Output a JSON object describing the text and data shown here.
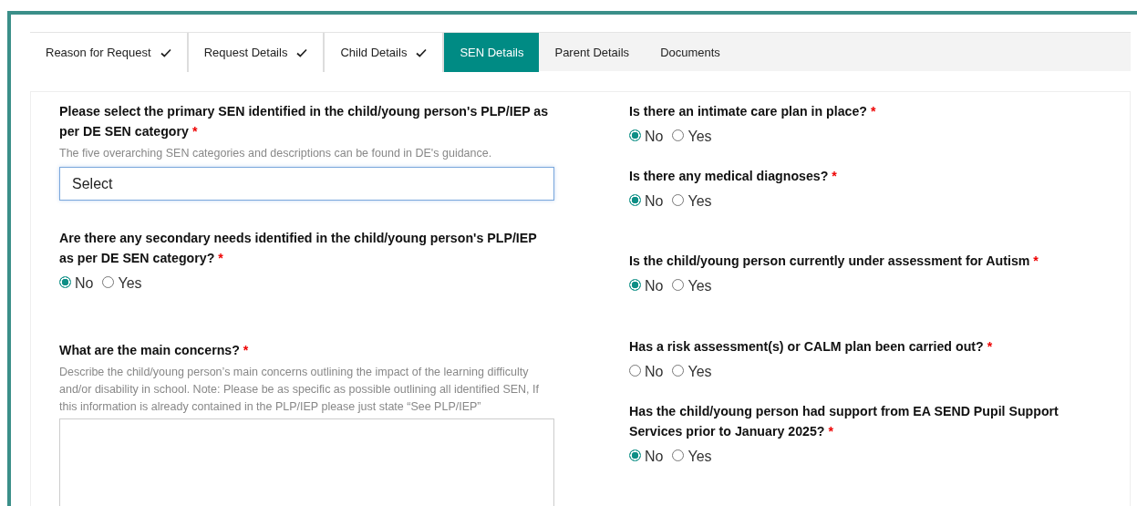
{
  "tabs": [
    {
      "label": "Reason for Request",
      "completed": true,
      "selected": false
    },
    {
      "label": "Request Details",
      "completed": true,
      "selected": false
    },
    {
      "label": "Child Details",
      "completed": true,
      "selected": false
    },
    {
      "label": "SEN Details",
      "completed": false,
      "selected": true
    },
    {
      "label": "Parent Details",
      "completed": false,
      "selected": false
    },
    {
      "label": "Documents",
      "completed": false,
      "selected": false
    }
  ],
  "left_column": [
    {
      "kind": "select",
      "label": "Please select the primary SEN identified in the child/young person's PLP/IEP as per DE SEN category",
      "required_mark": "*",
      "hint": "The five overarching SEN categories and descriptions can be found in DE's guidance.",
      "value": "Select"
    },
    {
      "kind": "radio",
      "label": "Are there any secondary needs identified in the child/young person's PLP/IEP as per DE SEN category?",
      "required_mark": "*",
      "options": [
        {
          "label": "No",
          "selected": true
        },
        {
          "label": "Yes",
          "selected": false
        }
      ]
    },
    {
      "kind": "textarea",
      "label": "What are the main concerns?",
      "required_mark": "*",
      "hint": "Describe the child/young person’s main concerns outlining the impact of the learning difficulty and/or disability in school. Note: Please be as specific as possible outlining all identified SEN, If this information is already contained in the PLP/IEP please just state “See PLP/IEP”"
    }
  ],
  "right_column": [
    {
      "kind": "radio",
      "label": "Is there an intimate care plan in place?",
      "required_mark": "*",
      "options": [
        {
          "label": "No",
          "selected": true
        },
        {
          "label": "Yes",
          "selected": false
        }
      ]
    },
    {
      "kind": "radio",
      "label": "Is there any medical diagnoses?",
      "required_mark": "*",
      "options": [
        {
          "label": "No",
          "selected": true
        },
        {
          "label": "Yes",
          "selected": false
        }
      ]
    },
    {
      "kind": "radio",
      "label": "Is the child/young person currently under assessment for Autism",
      "required_mark": "*",
      "options": [
        {
          "label": "No",
          "selected": true
        },
        {
          "label": "Yes",
          "selected": false
        }
      ]
    },
    {
      "kind": "radio",
      "label": "Has a risk assessment(s) or CALM plan been carried out?",
      "required_mark": "*",
      "options": [
        {
          "label": "No",
          "selected": false
        },
        {
          "label": "Yes",
          "selected": false
        }
      ]
    },
    {
      "kind": "radio",
      "label": "Has the child/young person had support from EA SEND Pupil Support Services prior to January 2025?",
      "required_mark": "*",
      "options": [
        {
          "label": "No",
          "selected": true
        },
        {
          "label": "Yes",
          "selected": false
        }
      ]
    }
  ]
}
